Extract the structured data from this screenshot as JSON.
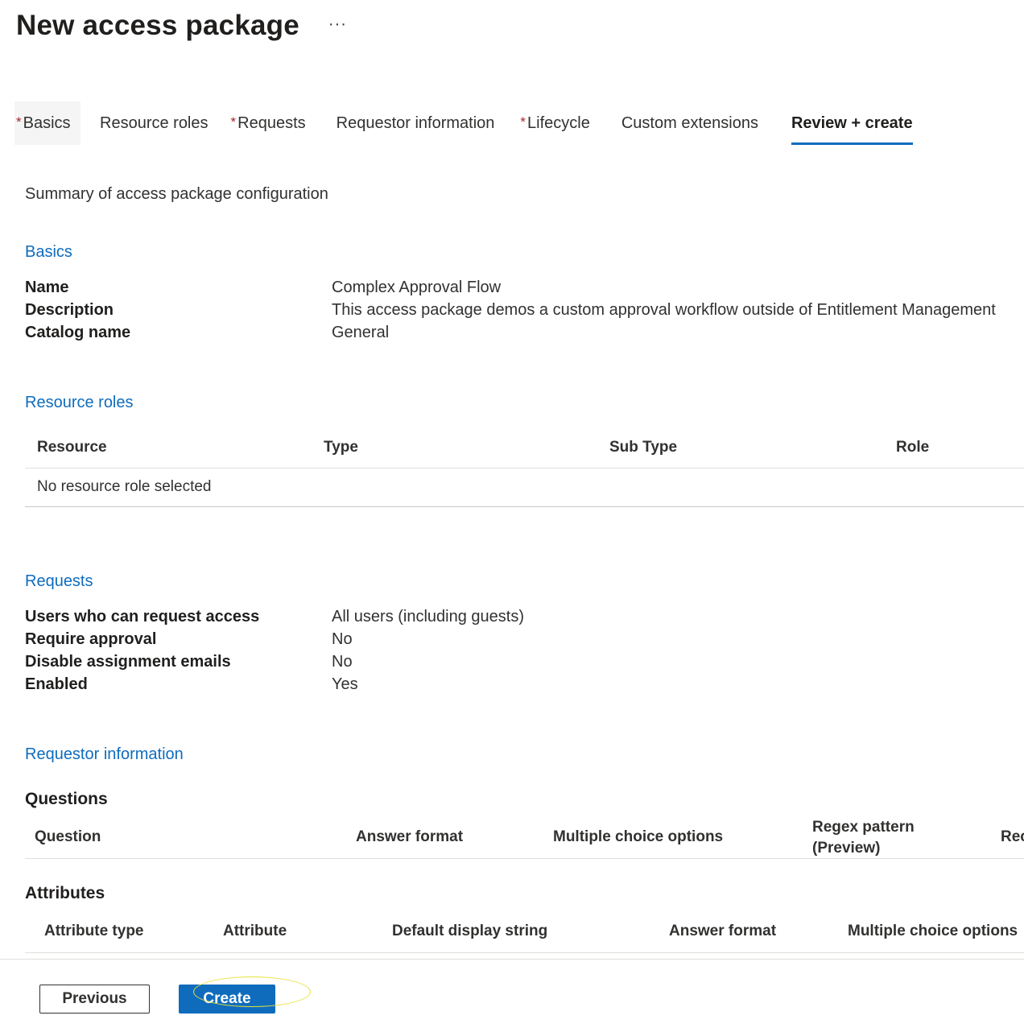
{
  "header": {
    "title": "New access package",
    "more_label": "···"
  },
  "tabs": [
    {
      "label": "Basics",
      "required": "*"
    },
    {
      "label": "Resource roles",
      "required": ""
    },
    {
      "label": "Requests",
      "required": "*"
    },
    {
      "label": "Requestor information",
      "required": ""
    },
    {
      "label": "Lifecycle",
      "required": "*"
    },
    {
      "label": "Custom extensions",
      "required": ""
    },
    {
      "label": "Review + create",
      "required": ""
    }
  ],
  "summary": "Summary of access package configuration",
  "basics": {
    "title": "Basics",
    "rows": [
      {
        "key": "Name",
        "value": "Complex Approval Flow"
      },
      {
        "key": "Description",
        "value": "This access package demos a custom approval workflow outside of Entitlement Management"
      },
      {
        "key": "Catalog name",
        "value": "General"
      }
    ]
  },
  "resource_roles": {
    "title": "Resource roles",
    "columns": [
      "Resource",
      "Type",
      "Sub Type",
      "Role"
    ],
    "empty_text": "No resource role selected"
  },
  "requests": {
    "title": "Requests",
    "rows": [
      {
        "key": "Users who can request access",
        "value": "All users (including guests)"
      },
      {
        "key": "Require approval",
        "value": "No"
      },
      {
        "key": "Disable assignment emails",
        "value": "No"
      },
      {
        "key": "Enabled",
        "value": "Yes"
      }
    ]
  },
  "requestor_information": {
    "title": "Requestor information",
    "questions": {
      "heading": "Questions",
      "columns": [
        "Question",
        "Answer format",
        "Multiple choice options",
        "Regex pattern",
        "(Preview)",
        "Rec"
      ]
    },
    "attributes": {
      "heading": "Attributes",
      "columns": [
        "Attribute type",
        "Attribute",
        "Default display string",
        "Answer format",
        "Multiple choice options"
      ]
    }
  },
  "footer": {
    "previous_label": "Previous",
    "create_label": "Create"
  },
  "colors": {
    "accent": "#0f6cbd",
    "required": "#a4262c",
    "highlight": "#e8e23a"
  }
}
